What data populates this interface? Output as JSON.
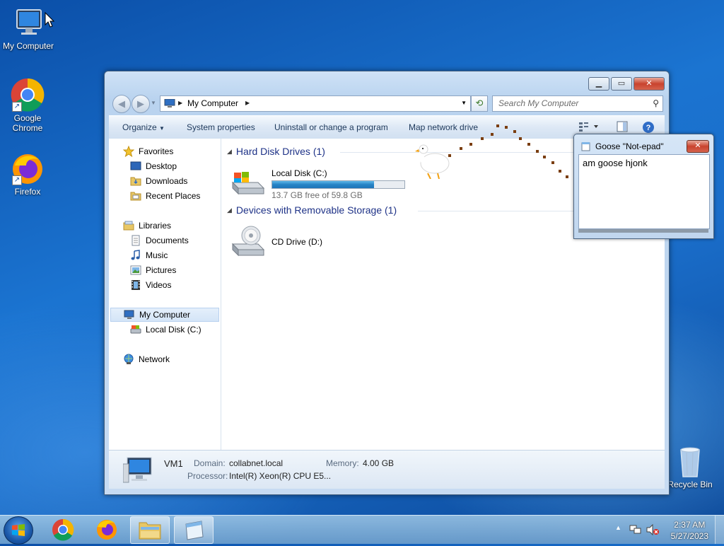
{
  "desktop": {
    "icons": [
      {
        "label": "My Computer",
        "icon": "computer-icon"
      },
      {
        "label": "Google Chrome",
        "icon": "chrome-icon"
      },
      {
        "label": "Firefox",
        "icon": "firefox-icon"
      },
      {
        "label": "Recycle Bin",
        "icon": "recycle-bin-icon"
      }
    ]
  },
  "explorer": {
    "address": {
      "crumb": "My Computer"
    },
    "search": {
      "placeholder": "Search My Computer"
    },
    "toolbar": {
      "organize": "Organize",
      "system_properties": "System properties",
      "uninstall": "Uninstall or change a program",
      "map_network": "Map network drive"
    },
    "navpane": {
      "favorites": "Favorites",
      "desktop": "Desktop",
      "downloads": "Downloads",
      "recent": "Recent Places",
      "libraries": "Libraries",
      "documents": "Documents",
      "music": "Music",
      "pictures": "Pictures",
      "videos": "Videos",
      "my_computer": "My Computer",
      "local_disk": "Local Disk (C:)",
      "network": "Network"
    },
    "groups": {
      "hdd": "Hard Disk Drives (1)",
      "removable": "Devices with Removable Storage (1)"
    },
    "drives": {
      "c_name": "Local Disk (C:)",
      "c_free": "13.7 GB free of 59.8 GB",
      "c_used_fraction": 0.77,
      "d_name": "CD Drive (D:)"
    },
    "details": {
      "name": "VM1",
      "domain_label": "Domain:",
      "domain": "collabnet.local",
      "memory_label": "Memory:",
      "memory": "4.00 GB",
      "processor_label": "Processor:",
      "processor": "Intel(R) Xeon(R) CPU E5..."
    }
  },
  "notepad": {
    "title": "Goose \"Not-epad\"",
    "text": "am goose hjonk"
  },
  "taskbar": {
    "time": "2:37 AM",
    "date": "5/27/2023"
  }
}
